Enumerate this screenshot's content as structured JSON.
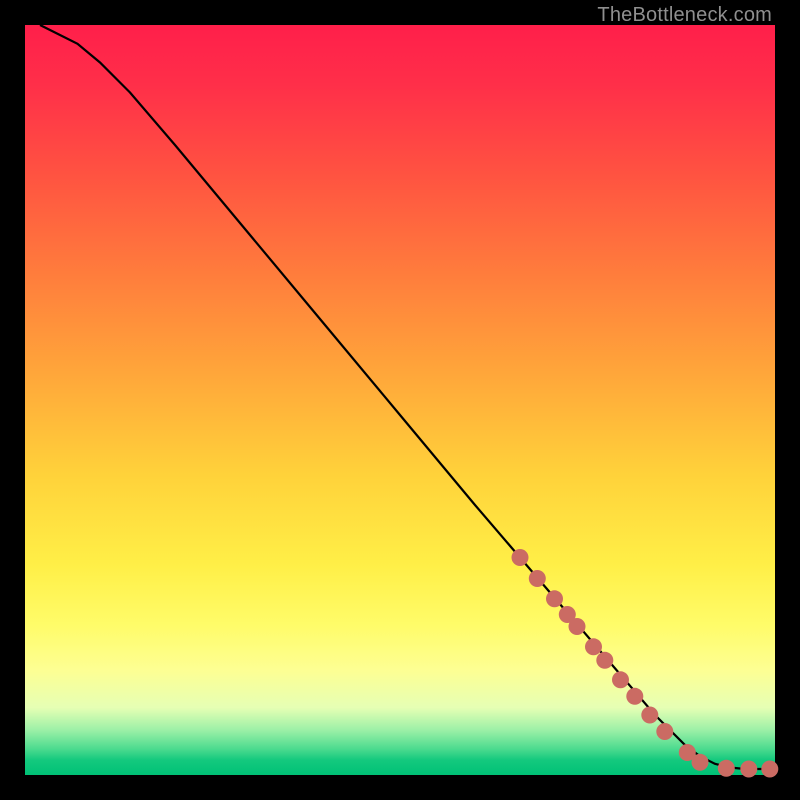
{
  "watermark": "TheBottleneck.com",
  "chart_data": {
    "type": "line",
    "title": "",
    "xlabel": "",
    "ylabel": "",
    "xlim": [
      0,
      100
    ],
    "ylim": [
      0,
      100
    ],
    "series": [
      {
        "name": "curve",
        "x": [
          2,
          4,
          7,
          10,
          14,
          20,
          30,
          40,
          50,
          60,
          66,
          72,
          78,
          84,
          88,
          90,
          92,
          94,
          96,
          98,
          100
        ],
        "y": [
          100,
          99,
          97.5,
          95,
          91,
          84,
          72,
          60,
          48,
          36,
          29,
          22,
          15,
          8,
          4,
          2.5,
          1.5,
          1,
          0.8,
          0.8,
          0.8
        ]
      }
    ],
    "markers": [
      {
        "x": 66,
        "y": 29
      },
      {
        "x": 68.3,
        "y": 26.2
      },
      {
        "x": 70.6,
        "y": 23.5
      },
      {
        "x": 72.3,
        "y": 21.4
      },
      {
        "x": 73.6,
        "y": 19.8
      },
      {
        "x": 75.8,
        "y": 17.1
      },
      {
        "x": 77.3,
        "y": 15.3
      },
      {
        "x": 79.4,
        "y": 12.7
      },
      {
        "x": 81.3,
        "y": 10.5
      },
      {
        "x": 83.3,
        "y": 8.0
      },
      {
        "x": 85.3,
        "y": 5.8
      },
      {
        "x": 88.3,
        "y": 3.0
      },
      {
        "x": 90.0,
        "y": 1.7
      },
      {
        "x": 93.5,
        "y": 0.9
      },
      {
        "x": 96.5,
        "y": 0.8
      },
      {
        "x": 99.3,
        "y": 0.8
      }
    ],
    "marker_color": "#cb6b63"
  }
}
